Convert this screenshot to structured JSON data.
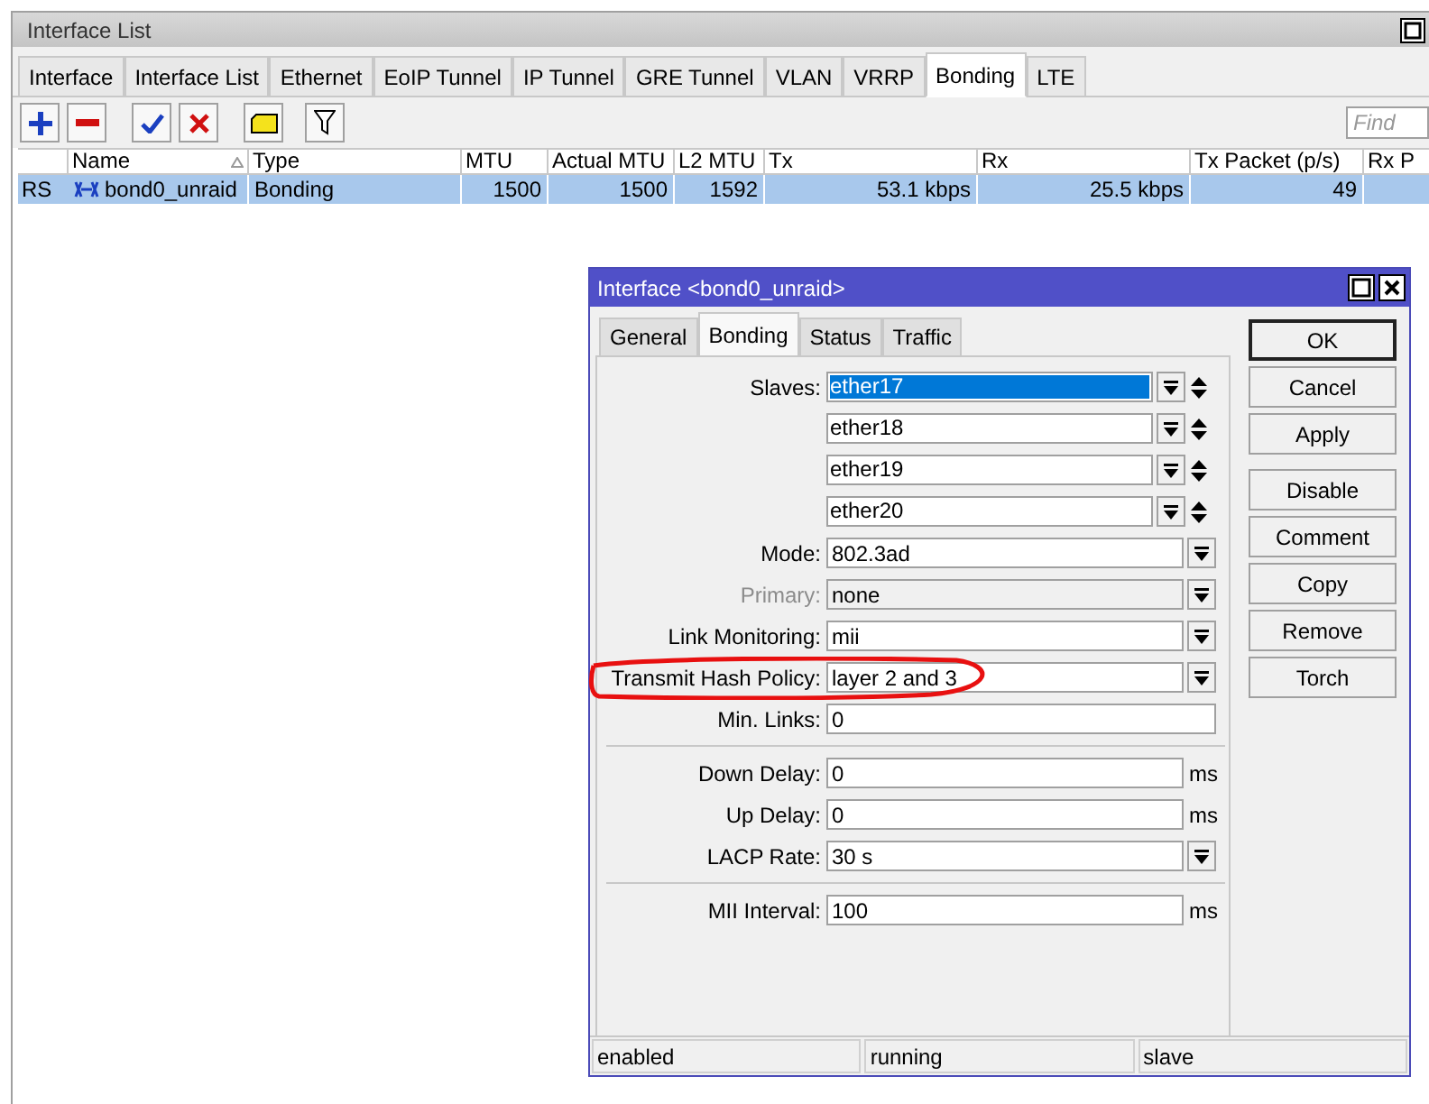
{
  "window": {
    "title": "Interface List"
  },
  "tabs": [
    {
      "label": "Interface",
      "selected": false
    },
    {
      "label": "Interface List",
      "selected": false
    },
    {
      "label": "Ethernet",
      "selected": false
    },
    {
      "label": "EoIP Tunnel",
      "selected": false
    },
    {
      "label": "IP Tunnel",
      "selected": false
    },
    {
      "label": "GRE Tunnel",
      "selected": false
    },
    {
      "label": "VLAN",
      "selected": false
    },
    {
      "label": "VRRP",
      "selected": false
    },
    {
      "label": "Bonding",
      "selected": true
    },
    {
      "label": "LTE",
      "selected": false
    }
  ],
  "find": {
    "placeholder": "Find"
  },
  "table": {
    "columns": [
      "Name",
      "Type",
      "MTU",
      "Actual MTU",
      "L2 MTU",
      "Tx",
      "Rx",
      "Tx Packet (p/s)",
      "Rx P"
    ],
    "rows": [
      {
        "flags": "RS",
        "cells": [
          "bond0_unraid",
          "Bonding",
          "1500",
          "1500",
          "1592",
          "53.1 kbps",
          "25.5 kbps",
          "49"
        ],
        "selected": true
      }
    ]
  },
  "dialog": {
    "title": "Interface <bond0_unraid>",
    "tabs": [
      {
        "label": "General",
        "selected": false
      },
      {
        "label": "Bonding",
        "selected": true
      },
      {
        "label": "Status",
        "selected": false
      },
      {
        "label": "Traffic",
        "selected": false
      }
    ],
    "fields": [
      {
        "kind": "slave",
        "label": "Slaves:",
        "value": "ether17",
        "selected": true
      },
      {
        "kind": "slave",
        "value": "ether18",
        "selected": false
      },
      {
        "kind": "slave",
        "value": "ether19",
        "selected": false
      },
      {
        "kind": "slave",
        "value": "ether20",
        "selected": false
      },
      {
        "kind": "select",
        "label": "Mode:",
        "value": "802.3ad",
        "disabled": false
      },
      {
        "kind": "select",
        "label": "Primary:",
        "value": "none",
        "disabled": true
      },
      {
        "kind": "select",
        "label": "Link Monitoring:",
        "value": "mii",
        "disabled": false
      },
      {
        "kind": "select",
        "label": "Transmit Hash Policy:",
        "value": "layer 2 and 3",
        "disabled": false
      },
      {
        "kind": "text",
        "label": "Min. Links:",
        "value": "0"
      },
      {
        "kind": "separator"
      },
      {
        "kind": "text",
        "label": "Down Delay:",
        "value": "0",
        "unit": "ms"
      },
      {
        "kind": "text",
        "label": "Up Delay:",
        "value": "0",
        "unit": "ms"
      },
      {
        "kind": "select",
        "label": "LACP Rate:",
        "value": "30 s",
        "disabled": false
      },
      {
        "kind": "separator"
      },
      {
        "kind": "text",
        "label": "MII Interval:",
        "value": "100",
        "unit": "ms"
      }
    ],
    "button_groups": [
      [
        {
          "label": "OK",
          "default": true
        },
        {
          "label": "Cancel",
          "default": false
        },
        {
          "label": "Apply",
          "default": false
        }
      ],
      [
        {
          "label": "Disable",
          "default": false
        },
        {
          "label": "Comment",
          "default": false
        },
        {
          "label": "Copy",
          "default": false
        },
        {
          "label": "Remove",
          "default": false
        },
        {
          "label": "Torch",
          "default": false
        }
      ]
    ],
    "status": [
      "enabled",
      "running",
      "slave"
    ]
  }
}
